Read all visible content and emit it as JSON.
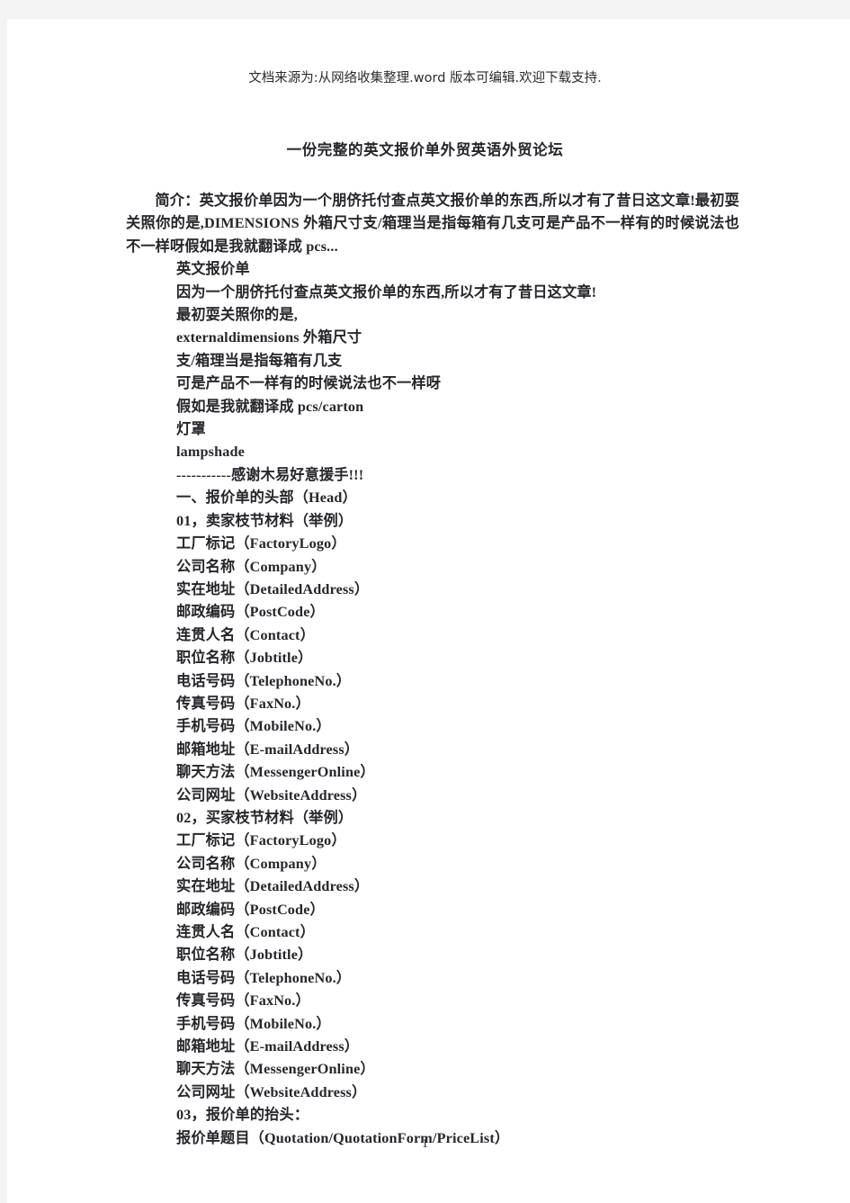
{
  "document": {
    "source_note": "文档来源为:从网络收集整理.word 版本可编辑.欢迎下载支持.",
    "title": "一份完整的英文报价单外贸英语外贸论坛",
    "intro_paragraph": "简介：英文报价单因为一个朋侪托付查点英文报价单的东西,所以才有了昔日这文章!最初耍关照你的是,DIMENSIONS 外箱尺寸支/箱理当是指每箱有几支可是产品不一样有的时候说法也不一样呀假如是我就翻译成 pcs...",
    "page_number": "1",
    "body_lines": [
      "英文报价单",
      "因为一个朋侪托付查点英文报价单的东西,所以才有了昔日这文章!",
      "最初耍关照你的是,",
      "externaldimensions 外箱尺寸",
      "支/箱理当是指每箱有几支",
      "可是产品不一样有的时候说法也不一样呀",
      "假如是我就翻译成 pcs/carton",
      "灯罩",
      "lampshade",
      "-----------感谢木易好意援手!!!",
      "一、报价单的头部（Head）",
      "01，卖家枝节材料（举例）",
      "工厂标记（FactoryLogo）",
      "公司名称（Company）",
      "实在地址（DetailedAddress）",
      "邮政编码（PostCode）",
      "连贯人名（Contact）",
      "职位名称（Jobtitle）",
      "电话号码（TelephoneNo.）",
      "传真号码（FaxNo.）",
      "手机号码（MobileNo.）",
      "邮箱地址（E-mailAddress）",
      "聊天方法（MessengerOnline）",
      "公司网址（WebsiteAddress）",
      "02，买家枝节材料（举例）",
      "工厂标记（FactoryLogo）",
      "公司名称（Company）",
      "实在地址（DetailedAddress）",
      "邮政编码（PostCode）",
      "连贯人名（Contact）",
      "职位名称（Jobtitle）",
      "电话号码（TelephoneNo.）",
      "传真号码（FaxNo.）",
      "手机号码（MobileNo.）",
      "邮箱地址（E-mailAddress）",
      "聊天方法（MessengerOnline）",
      "公司网址（WebsiteAddress）",
      "03，报价单的抬头：",
      "报价单题目（Quotation/QuotationForm/PriceList）"
    ]
  }
}
